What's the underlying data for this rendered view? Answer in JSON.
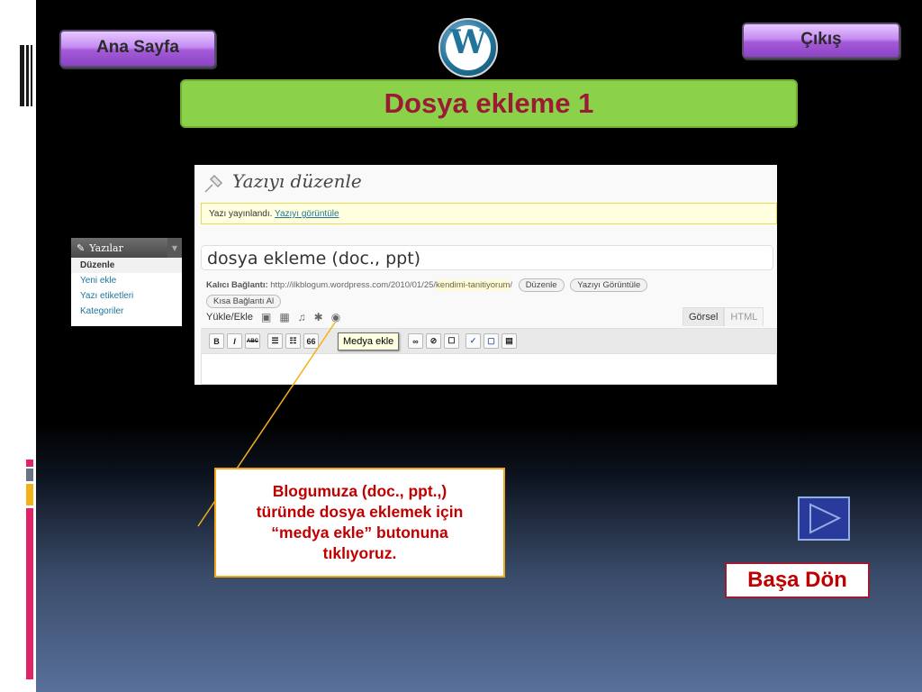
{
  "nav": {
    "home_label": "Ana Sayfa",
    "exit_label": "Çıkış",
    "logo_letter": "W"
  },
  "slide": {
    "title": "Dosya ekleme 1",
    "callout_line1": "Blogumuza (doc., ppt.,)",
    "callout_line2": "türünde dosya eklemek için",
    "callout_line3": "“medya ekle” butonuna",
    "callout_line4": "tıklıyoruz.",
    "basa_label": "Başa Dön"
  },
  "wp_screen": {
    "heading": "Yazıyı düzenle",
    "notice_text": "Yazı yayınlandı.",
    "notice_link": "Yazıyı görüntüle",
    "post_title": "dosya ekleme (doc., ppt)",
    "permalink_label": "Kalıcı Bağlantı:",
    "permalink_base": "http://ilkblogum.wordpress.com/2010/01/25/",
    "permalink_slug": "kendimi-tanitiyorum",
    "permalink_end": "/",
    "edit_btn": "Düzenle",
    "view_btn": "Yazıyı Görüntüle",
    "short_link_btn": "Kısa Bağlantı Al",
    "upload_label": "Yükle/Ekle",
    "tab_visual": "Görsel",
    "tab_html": "HTML",
    "tooltip": "Medya ekle",
    "toolbar_bold": "B",
    "toolbar_italic": "I",
    "toolbar_strike": "ABC",
    "toolbar_quote": "66"
  },
  "sidebar_menu": {
    "header": "Yazılar",
    "items": [
      {
        "label": "Düzenle",
        "selected": true
      },
      {
        "label": "Yeni ekle",
        "selected": false
      },
      {
        "label": "Yazı etiketleri",
        "selected": false
      },
      {
        "label": "Kategoriler",
        "selected": false
      }
    ]
  },
  "colors": {
    "title_bg": "#8cd14a",
    "title_text": "#9c1b34",
    "callout_border": "#f2a51a",
    "callout_text": "#c00000",
    "accent_pink": "#e0246a",
    "accent_yellow": "#f2b21a"
  }
}
